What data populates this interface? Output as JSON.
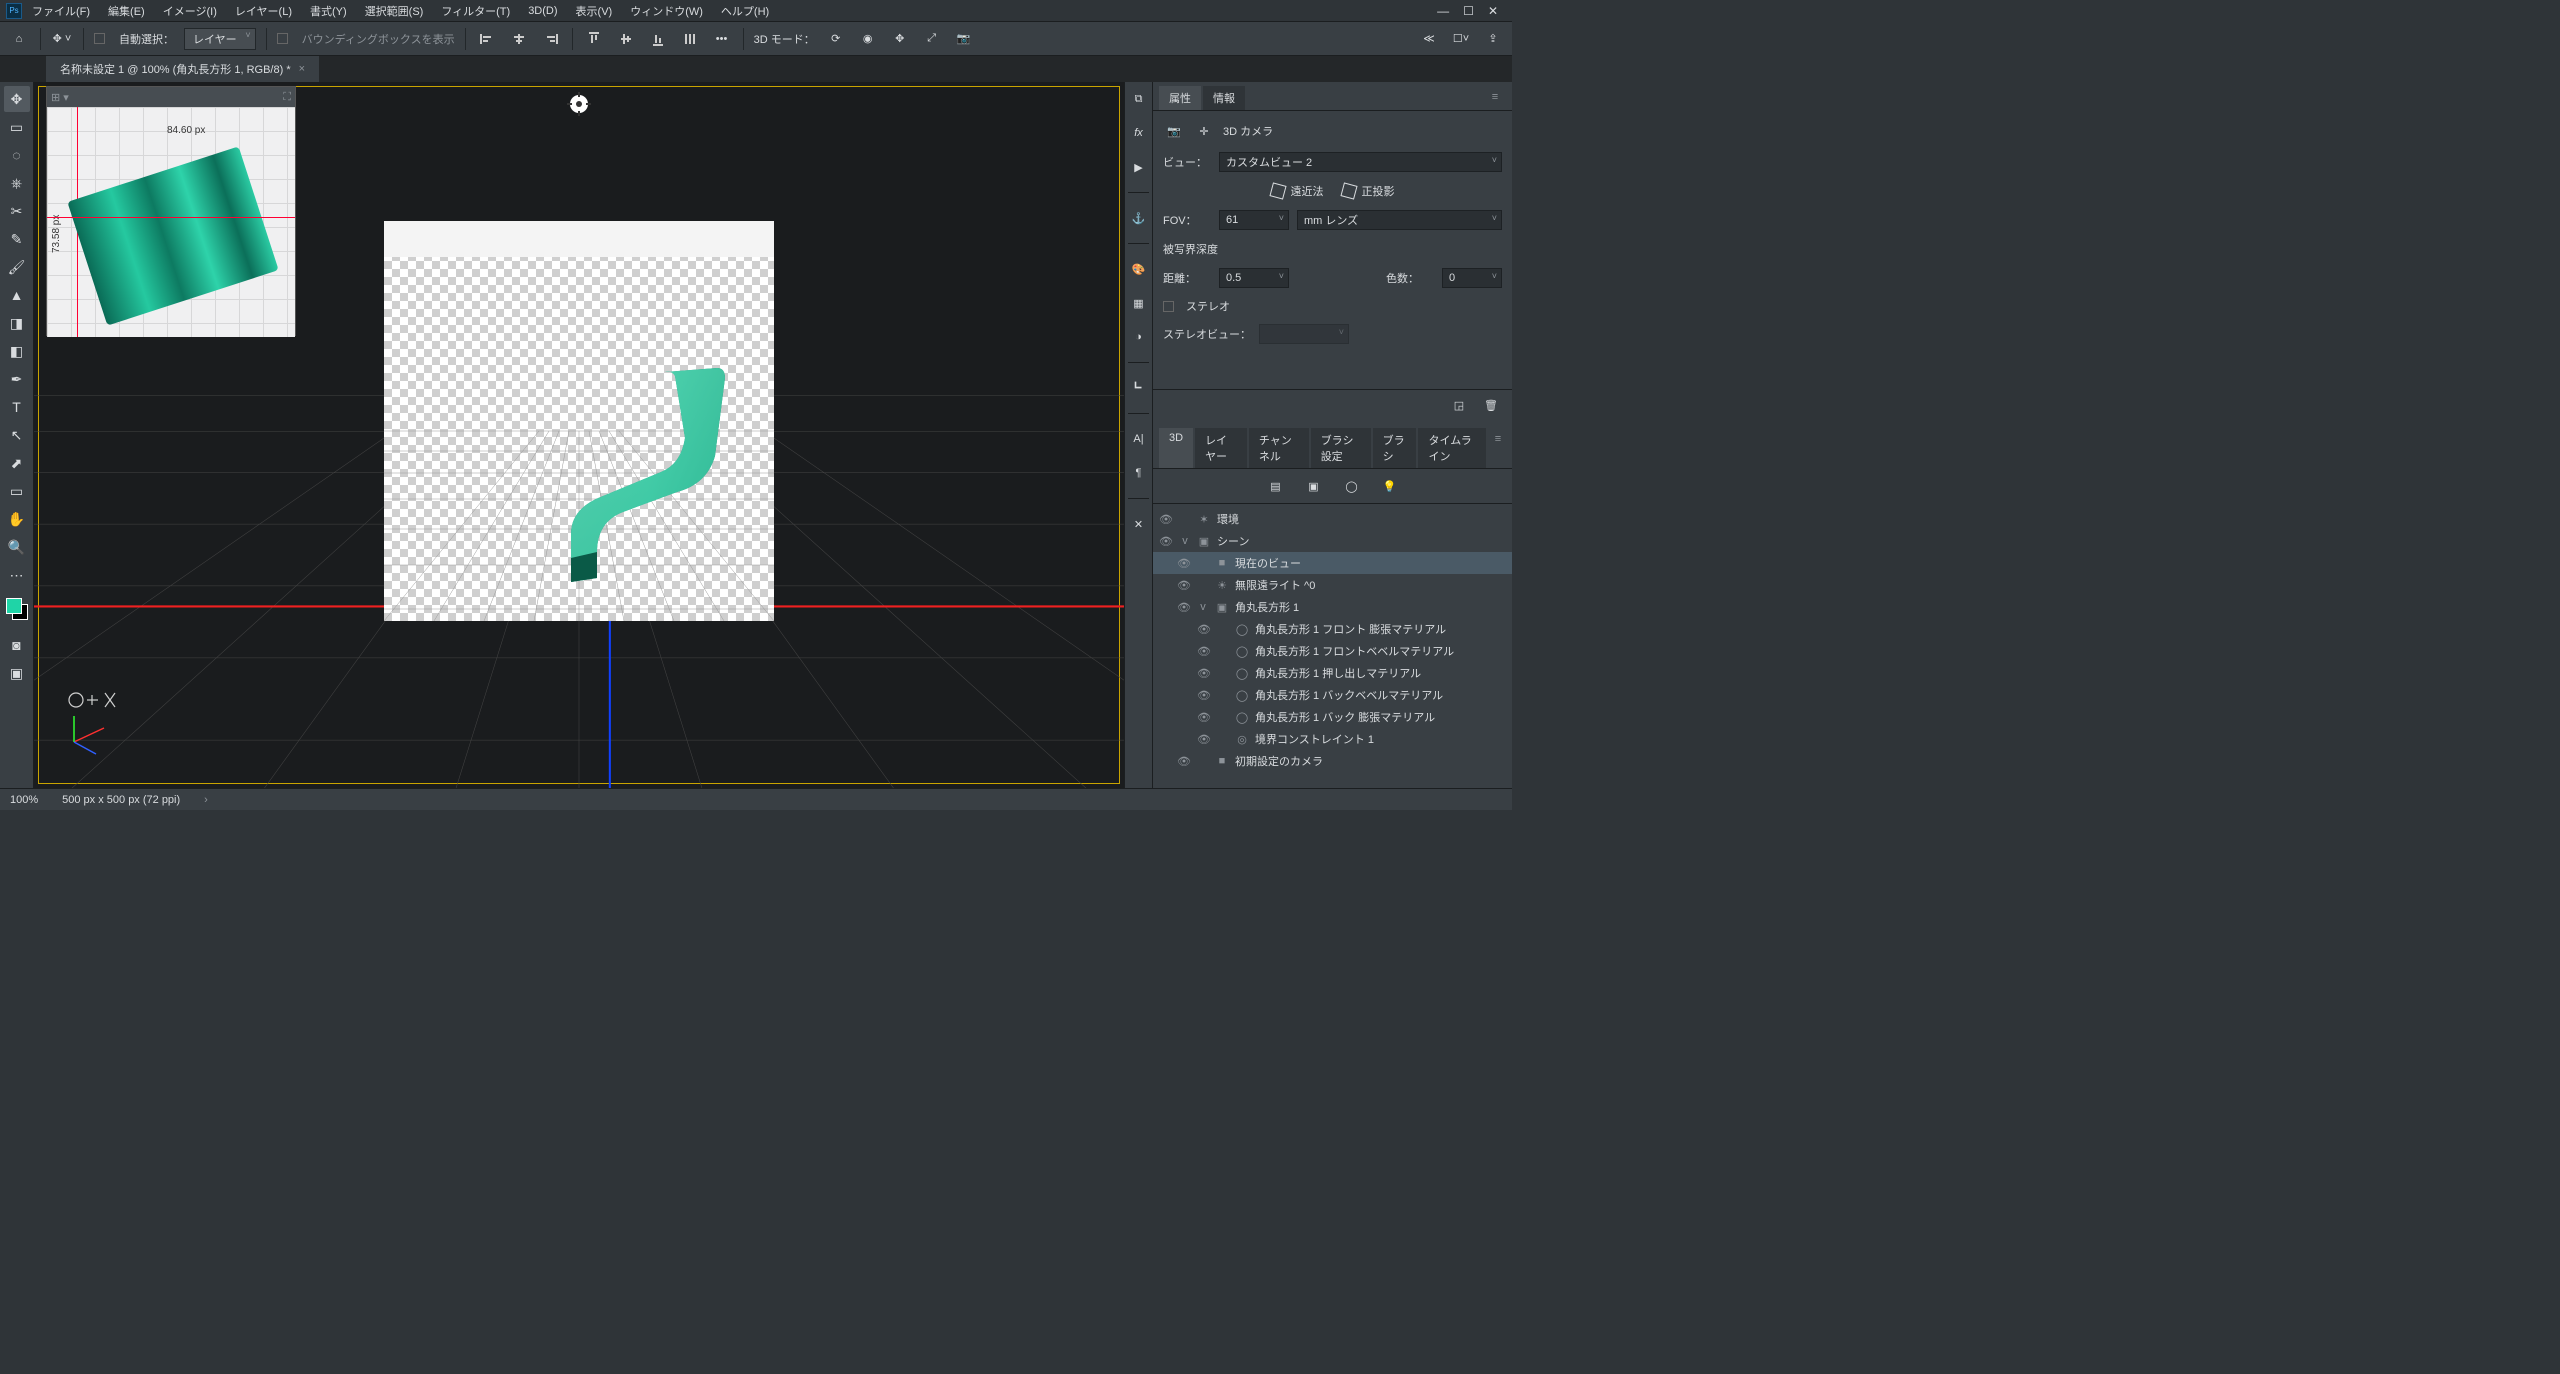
{
  "menu": {
    "items": [
      "ファイル(F)",
      "編集(E)",
      "イメージ(I)",
      "レイヤー(L)",
      "書式(Y)",
      "選択範囲(S)",
      "フィルター(T)",
      "3D(D)",
      "表示(V)",
      "ウィンドウ(W)",
      "ヘルプ(H)"
    ]
  },
  "optbar": {
    "auto_select": "自動選択：",
    "auto_select_mode": "レイヤー",
    "show_bbox": "バウンディングボックスを表示",
    "mode_label": "3D モード："
  },
  "doc": {
    "tab_title": "名称未設定 1 @ 100% (角丸長方形 1, RGB/8) *"
  },
  "navigator": {
    "dim_x": "84.60 px",
    "dim_y": "73.58 px"
  },
  "status": {
    "zoom": "100%",
    "dims": "500 px x 500 px (72 ppi)"
  },
  "props": {
    "tab_props": "属性",
    "tab_info": "情報",
    "section_title": "3D カメラ",
    "view_label": "ビュー：",
    "view_value": "カスタムビュー 2",
    "persp": "遠近法",
    "ortho": "正投影",
    "fov_label": "FOV：",
    "fov_value": "61",
    "fov_unit": "mm レンズ",
    "dof_label": "被写界深度",
    "dist_label": "距離：",
    "dist_value": "0.5",
    "shiki_label": "色数：",
    "shiki_value": "0",
    "stereo_cb": "ステレオ",
    "stereo_view": "ステレオビュー："
  },
  "panel3d": {
    "tabs": [
      "3D",
      "レイヤー",
      "チャンネル",
      "ブラシ設定",
      "ブラシ",
      "タイムライン"
    ],
    "tree": [
      {
        "d": 0,
        "icon": "✶",
        "label": "環境"
      },
      {
        "d": 0,
        "icon": "▣",
        "label": "シーン",
        "tw": "v"
      },
      {
        "d": 1,
        "icon": "■",
        "label": "現在のビュー",
        "sel": true
      },
      {
        "d": 1,
        "icon": "☀",
        "label": "無限遠ライト ^0"
      },
      {
        "d": 1,
        "icon": "▣",
        "label": "角丸長方形 1",
        "tw": "v"
      },
      {
        "d": 2,
        "icon": "◯",
        "label": "角丸長方形 1 フロント 膨張マテリアル"
      },
      {
        "d": 2,
        "icon": "◯",
        "label": "角丸長方形 1 フロントベベルマテリアル"
      },
      {
        "d": 2,
        "icon": "◯",
        "label": "角丸長方形 1 押し出しマテリアル"
      },
      {
        "d": 2,
        "icon": "◯",
        "label": "角丸長方形 1 バックベベルマテリアル"
      },
      {
        "d": 2,
        "icon": "◯",
        "label": "角丸長方形 1 バック 膨張マテリアル"
      },
      {
        "d": 2,
        "icon": "◎",
        "label": "境界コンストレイント 1"
      },
      {
        "d": 1,
        "icon": "■",
        "label": "初期設定のカメラ"
      }
    ]
  }
}
